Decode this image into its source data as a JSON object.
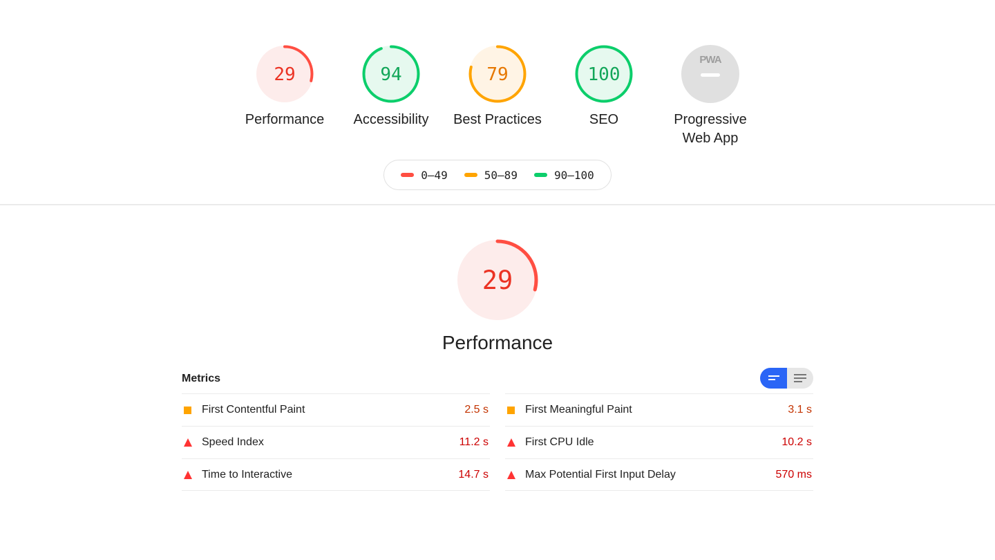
{
  "colors": {
    "fail": "#ff4e42",
    "fail_bg": "#fdeceb",
    "fail_text": "#eb3223",
    "average": "#ffa400",
    "average_bg": "#fff4e5",
    "average_text": "#e67700",
    "average_value": "#c33300",
    "pass": "#0cce6b",
    "pass_bg": "#e6f9ef",
    "pass_text": "#12a659",
    "na": "#e0e0e0",
    "na_text": "#9e9e9e",
    "toggle_active": "#2a65f6",
    "fail_value": "#cc0000"
  },
  "categories": [
    {
      "id": "performance",
      "label": "Performance",
      "score": 29,
      "display": "29",
      "rating": "fail"
    },
    {
      "id": "accessibility",
      "label": "Accessibility",
      "score": 94,
      "display": "94",
      "rating": "pass"
    },
    {
      "id": "best-practices",
      "label": "Best Practices",
      "score": 79,
      "display": "79",
      "rating": "average"
    },
    {
      "id": "seo",
      "label": "SEO",
      "score": 100,
      "display": "100",
      "rating": "pass"
    },
    {
      "id": "pwa",
      "label": "Progressive Web App",
      "label_line1": "Progressive",
      "label_line2": "Web App",
      "score": null,
      "display": "PWA",
      "rating": "na"
    }
  ],
  "legend": [
    {
      "label": "0–49",
      "rating": "fail"
    },
    {
      "label": "50–89",
      "rating": "average"
    },
    {
      "label": "90–100",
      "rating": "pass"
    }
  ],
  "performance_section": {
    "score": 29,
    "display": "29",
    "label": "Performance"
  },
  "metrics": {
    "title": "Metrics",
    "toggle": {
      "active": "summary",
      "summary_icon": "compact-view-icon",
      "expanded_icon": "expanded-view-icon"
    },
    "left": [
      {
        "name": "First Contentful Paint",
        "value": "2.5 s",
        "rating": "average",
        "icon": "square-icon"
      },
      {
        "name": "Speed Index",
        "value": "11.2 s",
        "rating": "fail",
        "icon": "triangle-icon"
      },
      {
        "name": "Time to Interactive",
        "value": "14.7 s",
        "rating": "fail",
        "icon": "triangle-icon"
      }
    ],
    "right": [
      {
        "name": "First Meaningful Paint",
        "value": "3.1 s",
        "rating": "average",
        "icon": "square-icon"
      },
      {
        "name": "First CPU Idle",
        "value": "10.2 s",
        "rating": "fail",
        "icon": "triangle-icon"
      },
      {
        "name": "Max Potential First Input Delay",
        "value": "570 ms",
        "rating": "fail",
        "icon": "triangle-icon"
      }
    ]
  }
}
